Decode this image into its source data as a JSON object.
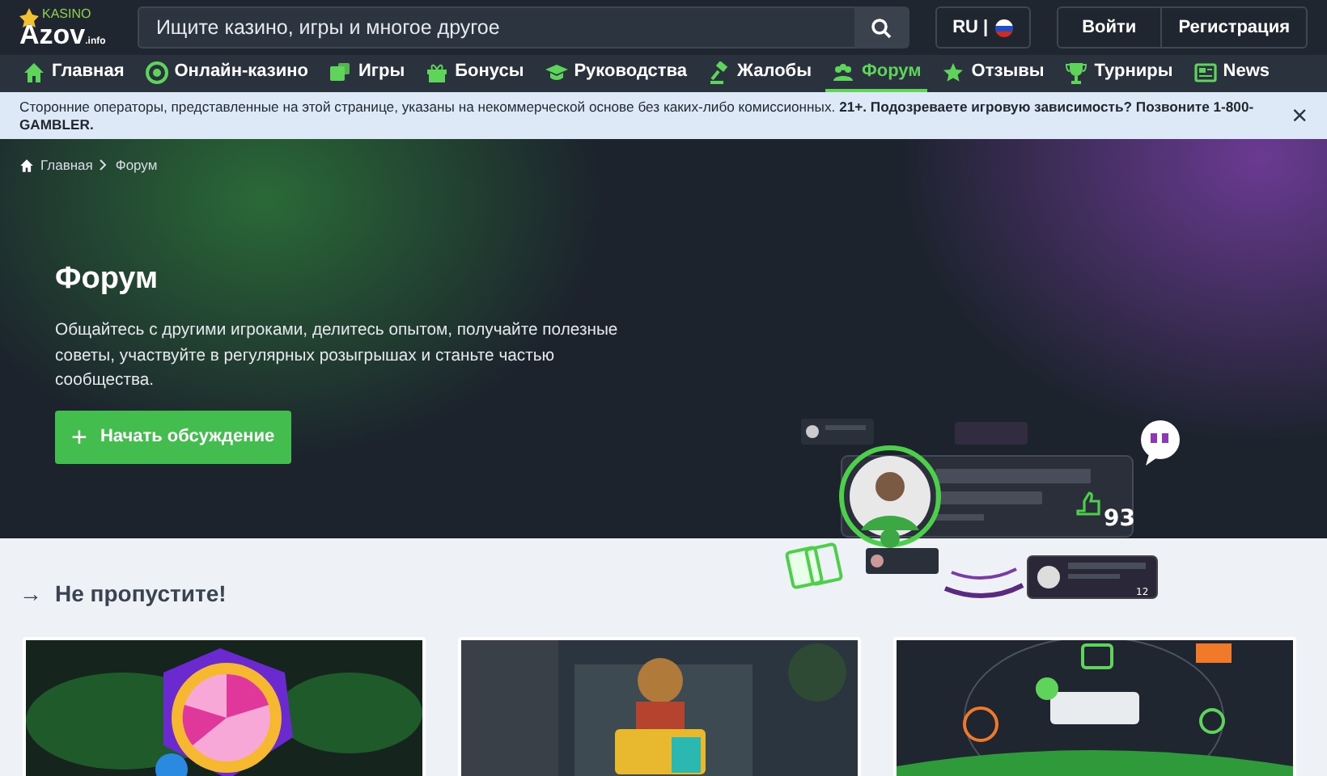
{
  "header": {
    "logo_top": "KASINO",
    "logo_main": "Azov",
    "logo_suffix": ".info",
    "search": {
      "placeholder": "Ищите казино, игры и многое другое"
    },
    "language": "RU |",
    "buttons": [
      "Войти",
      "Регистрация"
    ]
  },
  "nav": [
    {
      "label": "Главная",
      "selected": false
    },
    {
      "label": "Онлайн-казино",
      "selected": false
    },
    {
      "label": "Игры",
      "selected": false
    },
    {
      "label": "Бонусы",
      "selected": false
    },
    {
      "label": "Руководства",
      "selected": false
    },
    {
      "label": "Жалобы",
      "selected": false
    },
    {
      "label": "Форум",
      "selected": true
    },
    {
      "label": "Отзывы",
      "selected": false
    },
    {
      "label": "Турниры",
      "selected": false
    },
    {
      "label": "News",
      "selected": false
    }
  ],
  "notice": {
    "text": "Сторонние операторы, представленные на этой странице, указаны на некоммерческой основе без каких-либо комиссионных. **21+. Подозреваете игровую зависимость? Позвоните 1-800-GAMBLER.**",
    "close": "×"
  },
  "breadcrumb": [
    "Главная",
    "Форум"
  ],
  "hero": {
    "title": "Форум",
    "text": "Общайтесь с другими игроками, делитесь опытом, получайте полезные советы, участвуйте в регулярных розыгрышах и станьте частью сообщества.",
    "button": {
      "icon": "+",
      "label": "Начать обсуждение"
    },
    "illustration": {
      "likes": "93",
      "small_likes": "12"
    }
  },
  "section": {
    "arrow": "→",
    "title": "Не пропустите!"
  }
}
